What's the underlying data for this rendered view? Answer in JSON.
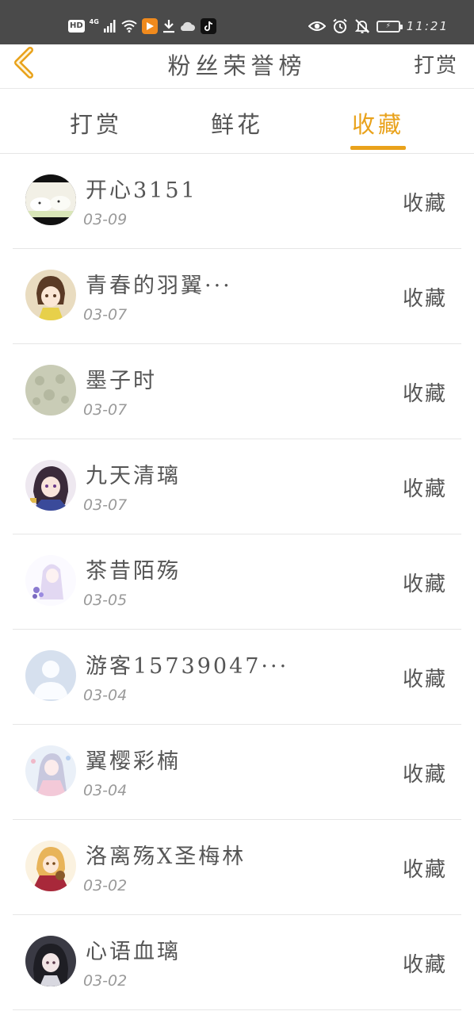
{
  "status_bar": {
    "hd": "HD",
    "network": "4G",
    "time": "11:21",
    "icons": [
      "signal-icon",
      "wifi-icon",
      "video-app-icon",
      "download-icon",
      "cloud-icon",
      "tiktok-icon",
      "eye-icon",
      "alarm-icon",
      "bell-off-icon",
      "battery-icon"
    ]
  },
  "nav": {
    "title": "粉丝荣誉榜",
    "action": "打赏",
    "back_icon": "chevron-left-icon",
    "accent": "#e9a21b"
  },
  "tabs": [
    {
      "label": "打赏",
      "active": false
    },
    {
      "label": "鲜花",
      "active": false
    },
    {
      "label": "收藏",
      "active": true
    }
  ],
  "list": [
    {
      "name": "开心3151",
      "date": "03-09",
      "action": "收藏"
    },
    {
      "name": "青春的羽翼···",
      "date": "03-07",
      "action": "收藏"
    },
    {
      "name": "墨子时",
      "date": "03-07",
      "action": "收藏"
    },
    {
      "name": "九天清璃",
      "date": "03-07",
      "action": "收藏"
    },
    {
      "name": "茶昔陌殇",
      "date": "03-05",
      "action": "收藏"
    },
    {
      "name": "游客15739047···",
      "date": "03-04",
      "action": "收藏"
    },
    {
      "name": "翼樱彩楠",
      "date": "03-04",
      "action": "收藏"
    },
    {
      "name": "洛离殇X圣梅林",
      "date": "03-02",
      "action": "收藏"
    },
    {
      "name": "心语血璃",
      "date": "03-02",
      "action": "收藏"
    }
  ]
}
